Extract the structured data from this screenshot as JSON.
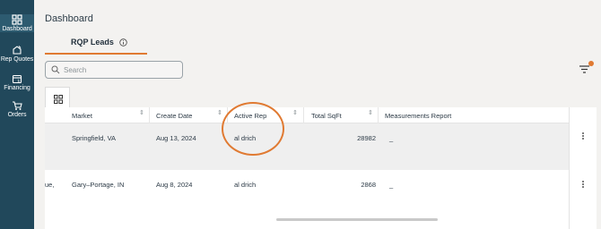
{
  "sidebar": {
    "items": [
      {
        "label": "Dashboard",
        "icon": "dashboard-icon",
        "active": true
      },
      {
        "label": "Rep Quotes",
        "icon": "quotes-icon"
      },
      {
        "label": "Financing",
        "icon": "financing-icon"
      },
      {
        "label": "Orders",
        "icon": "orders-icon"
      }
    ]
  },
  "header": {
    "title": "Dashboard"
  },
  "tabs": [
    {
      "label": "RQP Leads",
      "active": true
    }
  ],
  "search": {
    "placeholder": "Search",
    "value": ""
  },
  "table": {
    "columns": [
      "Market",
      "Create Date",
      "Active Rep",
      "Total SqFt",
      "Measurements Report"
    ],
    "rows": [
      {
        "left_fragment": "",
        "market": "Springfield, VA",
        "create_date": "Aug 13, 2024",
        "active_rep": "al drich",
        "total_sqft": "28982",
        "report": "_"
      },
      {
        "left_fragment": "ue,",
        "market": "Gary–Portage, IN",
        "create_date": "Aug 8, 2024",
        "active_rep": "al drich",
        "total_sqft": "2868",
        "report": "_"
      }
    ]
  },
  "colors": {
    "sidebar": "#21485b",
    "accent": "#e07a32",
    "highlight_row": "#efefef"
  }
}
